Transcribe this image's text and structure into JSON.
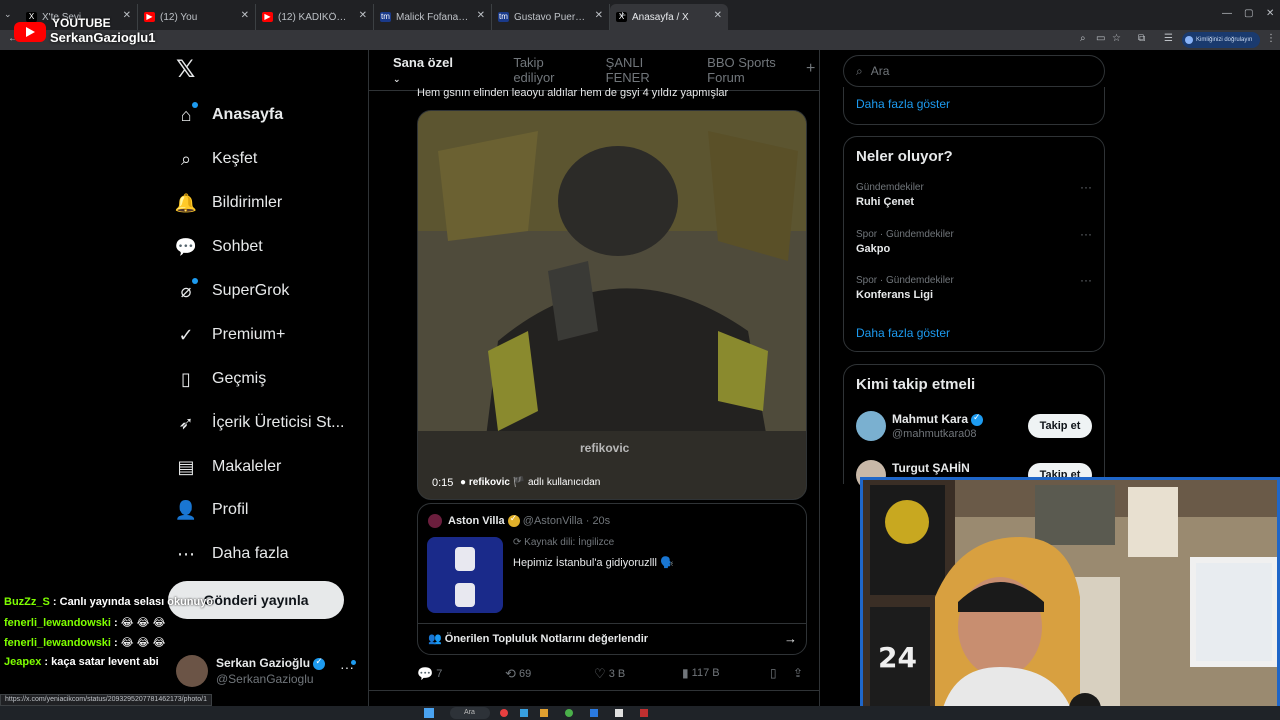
{
  "browser": {
    "tabs": [
      {
        "label": "X'te Sevi",
        "fav_color": "#000000",
        "fav_text": "X",
        "active": false
      },
      {
        "label": "(12) You",
        "fav_color": "#ff0000",
        "fav_text": "▶",
        "active": false
      },
      {
        "label": "(12) KADIKÖY'DE GÖRSEL ŞÖLE",
        "fav_color": "#ff0000",
        "fav_text": "▶",
        "active": false
      },
      {
        "label": "Malick Fofana - Oyuncu profili",
        "fav_color": "#1a3a8a",
        "fav_text": "tm",
        "active": false
      },
      {
        "label": "Gustavo Puerta - Oyuncu profili",
        "fav_color": "#1a3a8a",
        "fav_text": "tm",
        "active": false
      },
      {
        "label": "Anasayfa / X",
        "fav_color": "#000000",
        "fav_text": "X",
        "active": true
      }
    ],
    "new_tab": "+",
    "profile_chip": "Kimliğinizi doğrulayın",
    "status_url": "https://x.com/yeniacikcom/status/2093295207781462173/photo/1"
  },
  "overlay": {
    "youtube_label": "YOUTUBE",
    "channel_name": "SerkanGazioglu1"
  },
  "nav": {
    "items": [
      {
        "label": "Anasayfa",
        "icon": "home-icon",
        "glyph": "⌂",
        "bold": true,
        "dot": true
      },
      {
        "label": "Keşfet",
        "icon": "search-icon",
        "glyph": "⌕",
        "bold": false,
        "dot": false
      },
      {
        "label": "Bildirimler",
        "icon": "bell-icon",
        "glyph": "🔔",
        "bold": false,
        "dot": false
      },
      {
        "label": "Sohbet",
        "icon": "chat-icon",
        "glyph": "💬",
        "bold": false,
        "dot": false
      },
      {
        "label": "SuperGrok",
        "icon": "grok-icon",
        "glyph": "⌀",
        "bold": false,
        "dot": true
      },
      {
        "label": "Premium+",
        "icon": "premium-icon",
        "glyph": "✓",
        "bold": false,
        "dot": false
      },
      {
        "label": "Geçmiş",
        "icon": "bookmark-icon",
        "glyph": "▯",
        "bold": false,
        "dot": false
      },
      {
        "label": "İçerik Üreticisi St...",
        "icon": "rocket-icon",
        "glyph": "➶",
        "bold": false,
        "dot": false
      },
      {
        "label": "Makaleler",
        "icon": "article-icon",
        "glyph": "▤",
        "bold": false,
        "dot": false
      },
      {
        "label": "Profil",
        "icon": "profile-icon",
        "glyph": "👤",
        "bold": false,
        "dot": false
      },
      {
        "label": "Daha fazla",
        "icon": "more-icon",
        "glyph": "⋯",
        "bold": false,
        "dot": false
      }
    ],
    "post_button": "Gönderi yayınla"
  },
  "chat": [
    {
      "user": "BuzZz_S",
      "msg": ": Canlı yayında selası okunuyo"
    },
    {
      "user": "fenerli_lewandowski",
      "msg": ": 😂 😂 😂"
    },
    {
      "user": "fenerli_lewandowski",
      "msg": ": 😂 😂 😂"
    },
    {
      "user": "Jeapex",
      "msg": ": kaça satar levent abi"
    }
  ],
  "account": {
    "name": "Serkan Gazioğlu",
    "handle": "@SerkanGazioglu",
    "more": "···"
  },
  "feed": {
    "tabs": [
      "Sana özel",
      "Takip ediliyor",
      "ŞANLI FENER",
      "BBO Sports Forum"
    ],
    "add_tab": "+",
    "tweet_text": "Hem gsnın elinden leaoyu aldılar hem de gsyi 4 yıldız yapmışlar",
    "video": {
      "time": "0:15",
      "watermark": "refikovic",
      "credit_user": "refikovic 🏴",
      "credit_suffix": "adlı kullanıcıdan"
    },
    "quote": {
      "name": "Aston Villa",
      "handle": "@AstonVilla · 20s",
      "source": "Kaynak dili: İngilizce",
      "text": "Hepimiz İstanbul'a gidiyoruzlll 🗣️",
      "notes": "Önerilen Topluluk Notlarını değerlendir"
    },
    "actions": {
      "replies": "7",
      "reposts": "69",
      "likes": "3 B",
      "views": "117 B"
    }
  },
  "right": {
    "search_placeholder": "Ara",
    "show_more_1": "Daha fazla göster",
    "trends_title": "Neler oluyor?",
    "trends": [
      {
        "meta": "Gündemdekiler",
        "title": "Ruhi Çenet"
      },
      {
        "meta": "Spor · Gündemdekiler",
        "title": "Gakpo"
      },
      {
        "meta": "Spor · Gündemdekiler",
        "title": "Konferans Ligi"
      }
    ],
    "show_more_2": "Daha fazla göster",
    "who_title": "Kimi takip etmeli",
    "who": [
      {
        "name": "Mahmut Kara",
        "handle": "@mahmutkara08",
        "button": "Takip et"
      },
      {
        "name": "Turgut ŞAHİN",
        "handle": "",
        "button": "Takip et"
      }
    ]
  },
  "taskbar": {
    "search": "Ara"
  }
}
